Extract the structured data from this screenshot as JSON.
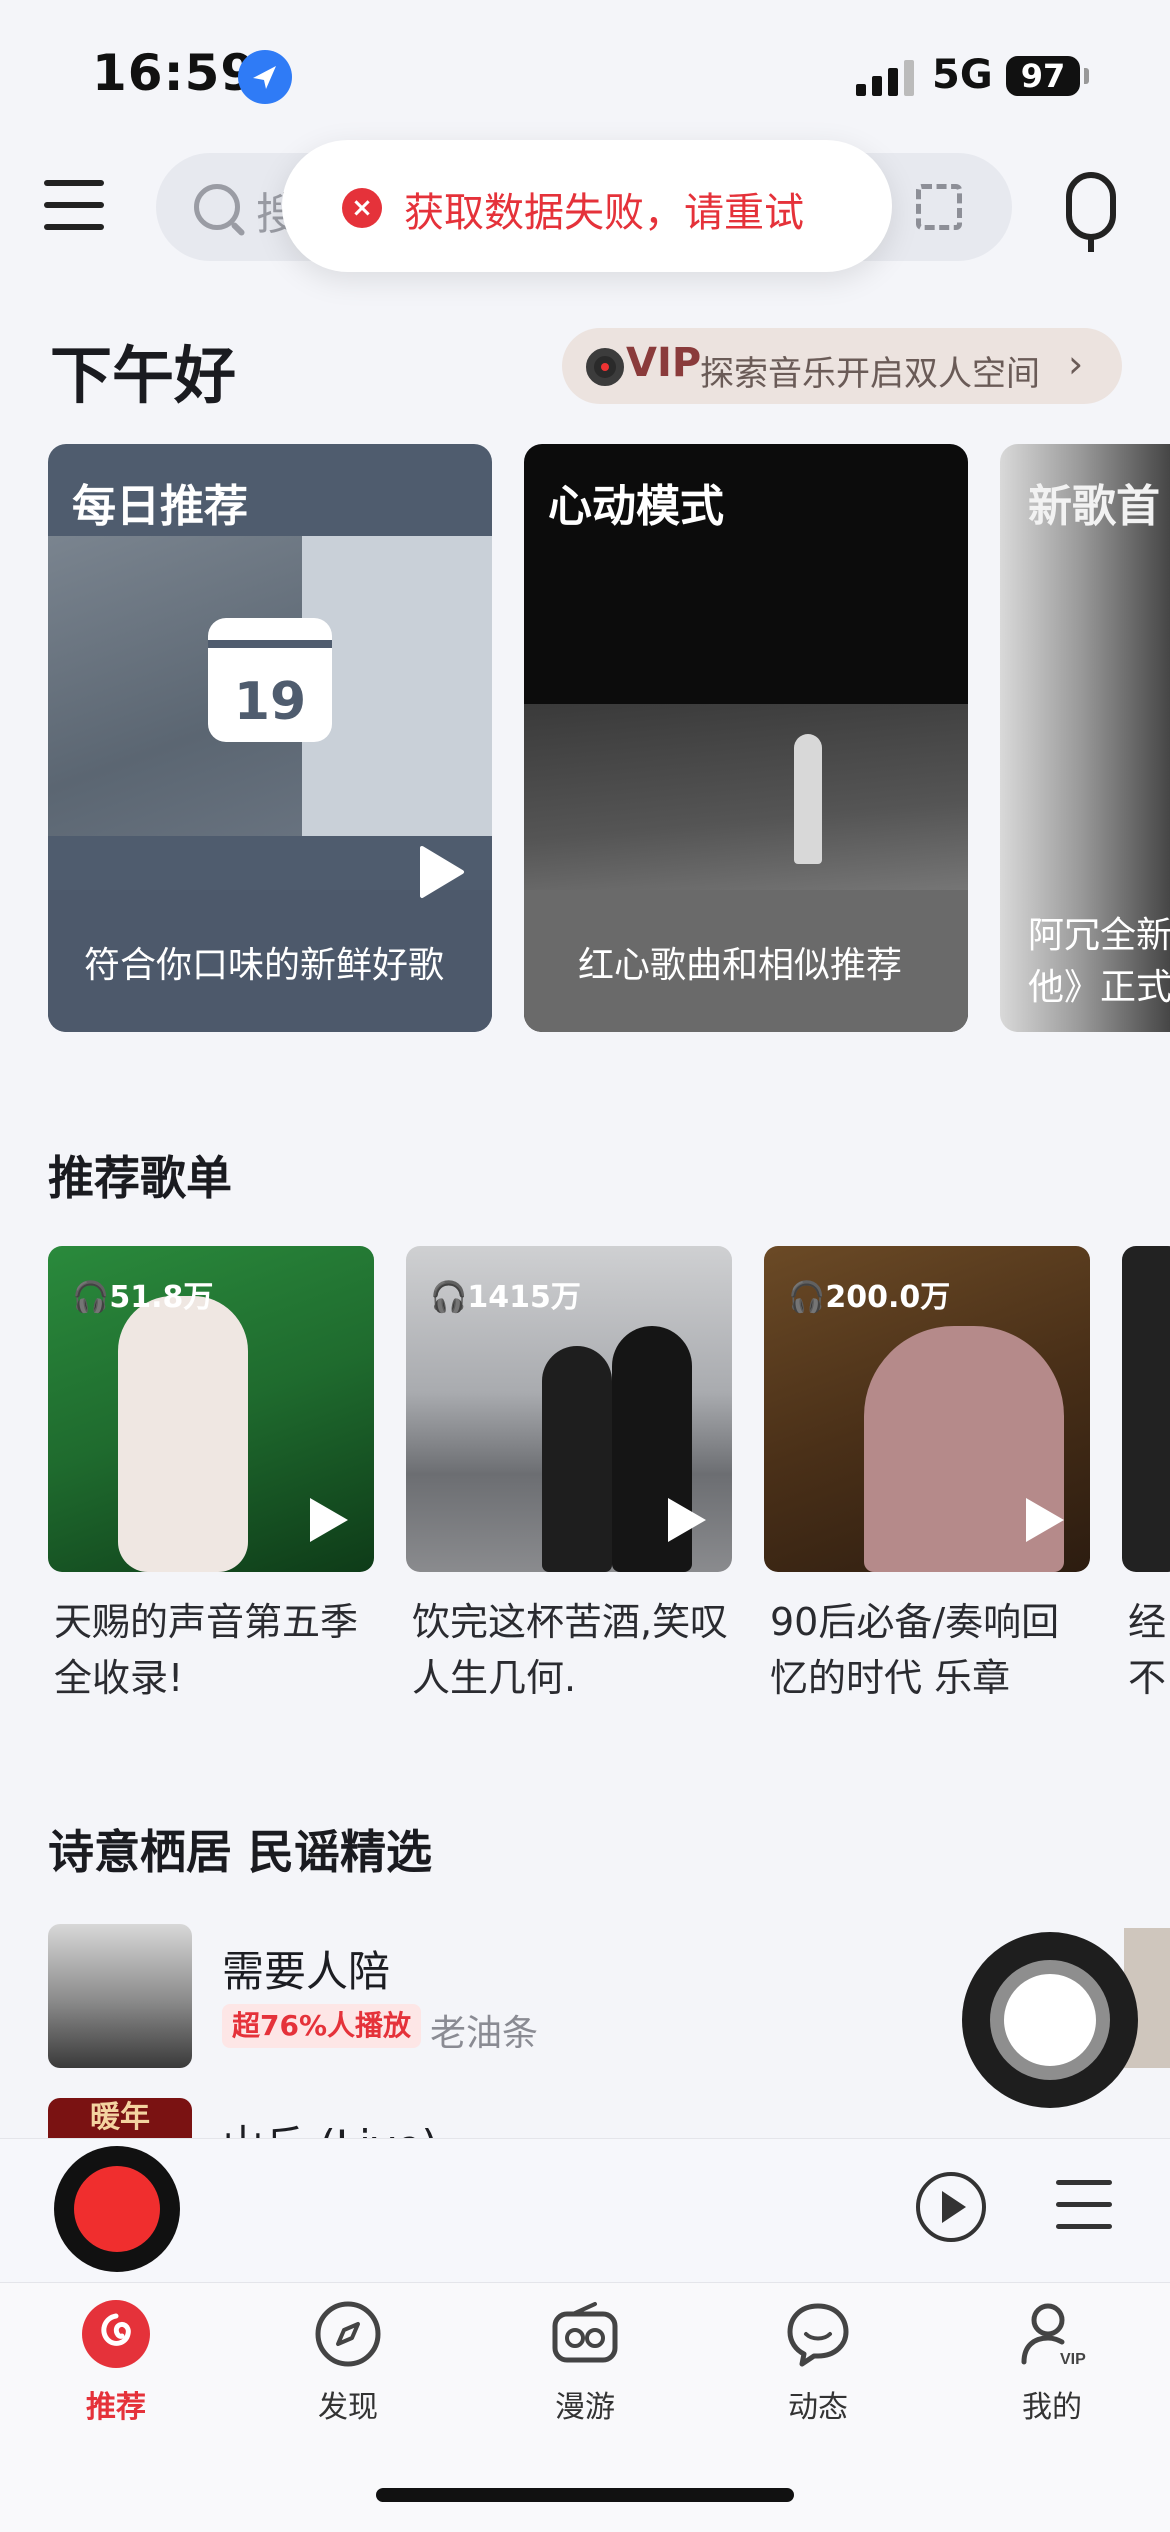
{
  "status_bar": {
    "time": "16:59",
    "network": "5G",
    "battery": "97"
  },
  "search": {
    "placeholder": "搜"
  },
  "toast": {
    "message": "获取数据失败，请重试"
  },
  "greeting": "下午好",
  "vip_banner": {
    "label": "VIP",
    "text": "探索音乐开启双人空间"
  },
  "feature_cards": [
    {
      "title": "每日推荐",
      "subtitle": "符合你口味的新鲜好歌",
      "calendar_day": "19"
    },
    {
      "title": "心动模式",
      "subtitle": "红心歌曲和相似推荐"
    },
    {
      "title": "新歌首",
      "subtitle_lines": [
        "阿冗全新",
        "他》正式"
      ]
    }
  ],
  "playlists_section": {
    "title": "推荐歌单",
    "items": [
      {
        "count": "51.8万",
        "title": "天赐的声音第五季全收录!"
      },
      {
        "count": "1415万",
        "title": "饮完这杯苦酒,笑叹人生几何."
      },
      {
        "count": "200.0万",
        "title": "90后必备/奏响回忆的时代 乐章"
      },
      {
        "count": "",
        "title": "经不"
      }
    ]
  },
  "folk_section": {
    "title": "诗意栖居 民谣精选",
    "songs": [
      {
        "title": "需要人陪",
        "badge": "超76%人播放",
        "artist": "老油条"
      },
      {
        "title": "山丘 (Live)",
        "art_text": "暖年"
      }
    ]
  },
  "tabs": [
    {
      "label": "推荐",
      "icon": "netease-logo-icon",
      "active": true
    },
    {
      "label": "发现",
      "icon": "compass-icon"
    },
    {
      "label": "漫游",
      "icon": "radio-icon"
    },
    {
      "label": "动态",
      "icon": "chat-bubble-icon"
    },
    {
      "label": "我的",
      "icon": "user-vip-icon"
    }
  ],
  "colors": {
    "accent": "#e5323a",
    "background": "#f4f5f9"
  }
}
